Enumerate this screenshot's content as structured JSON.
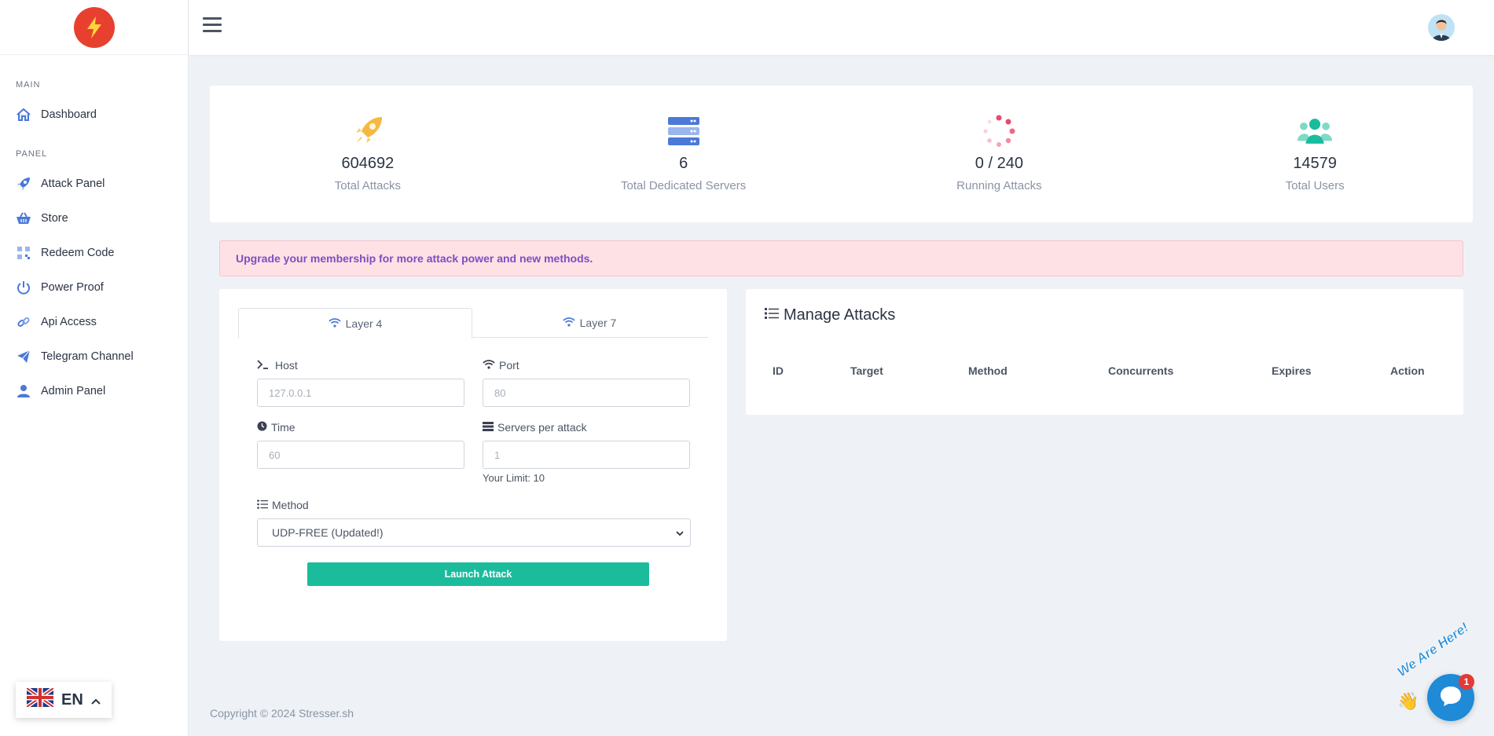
{
  "sidebar": {
    "section_main": "MAIN",
    "section_panel": "PANEL",
    "items": [
      {
        "label": "Dashboard",
        "icon": "home-icon"
      },
      {
        "label": "Attack Panel",
        "icon": "rocket-icon"
      },
      {
        "label": "Store",
        "icon": "basket-icon"
      },
      {
        "label": "Redeem Code",
        "icon": "qr-code-icon"
      },
      {
        "label": "Power Proof",
        "icon": "power-icon"
      },
      {
        "label": "Api Access",
        "icon": "link-icon"
      },
      {
        "label": "Telegram Channel",
        "icon": "paper-plane-icon"
      },
      {
        "label": "Admin Panel",
        "icon": "user-icon"
      }
    ],
    "language": "EN"
  },
  "stats": [
    {
      "value": "604692",
      "label": "Total Attacks",
      "icon": "rocket-icon"
    },
    {
      "value": "6",
      "label": "Total Dedicated Servers",
      "icon": "server-icon"
    },
    {
      "value": "0 / 240",
      "label": "Running Attacks",
      "icon": "spinner-icon"
    },
    {
      "value": "14579",
      "label": "Total Users",
      "icon": "users-icon"
    }
  ],
  "alert": "Upgrade your membership for more attack power and new methods.",
  "attack_form": {
    "tabs": [
      "Layer 4",
      "Layer 7"
    ],
    "host_label": "Host",
    "host_placeholder": "127.0.0.1",
    "port_label": "Port",
    "port_placeholder": "80",
    "time_label": "Time",
    "time_placeholder": "60",
    "servers_label": "Servers per attack",
    "servers_placeholder": "1",
    "limit_text": "Your Limit: 10",
    "method_label": "Method",
    "method_value": "UDP-FREE (Updated!)",
    "launch_label": "Launch Attack"
  },
  "manage": {
    "title": "Manage Attacks",
    "columns": [
      "ID",
      "Target",
      "Method",
      "Concurrents",
      "Expires",
      "Action"
    ]
  },
  "footer": "Copyright © 2024 Stresser.sh",
  "chat": {
    "tagline": "We Are Here!",
    "badge": "1"
  },
  "colors": {
    "accent": "#1abc9c",
    "logo": "#e8402f",
    "alert_bg": "#fde1e5",
    "alert_text": "#7d4ec3",
    "chat": "#1f8ad6"
  }
}
